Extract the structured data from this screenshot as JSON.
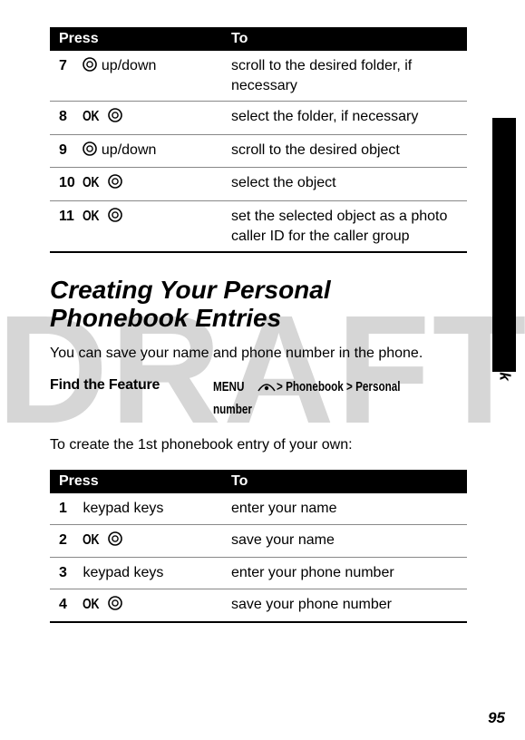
{
  "watermark": "DRAFT",
  "side_label": "Managing Your Phonebook",
  "page_number": "95",
  "table1": {
    "head_press": "Press",
    "head_to": "To",
    "rows": [
      {
        "num": "7",
        "key_prefix": "",
        "key_suffix": " up/down",
        "to": "scroll to the desired folder, if necessary"
      },
      {
        "num": "8",
        "key_prefix": "OK",
        "key_suffix": "",
        "to": "select the folder, if necessary"
      },
      {
        "num": "9",
        "key_prefix": "",
        "key_suffix": " up/down",
        "to": "scroll to the desired object"
      },
      {
        "num": "10",
        "key_prefix": "OK",
        "key_suffix": "",
        "to": "select the object"
      },
      {
        "num": "11",
        "key_prefix": "OK",
        "key_suffix": "",
        "to": "set the selected object as a photo caller ID for the caller group"
      }
    ]
  },
  "section_heading": "Creating Your Personal Phonebook Entries",
  "intro_para": "You can save your name and phone number in the phone.",
  "find_feature_label": "Find the Feature",
  "menu_label": "MENU",
  "menu_path_1": " > Phonebook > Personal",
  "menu_path_2": "number",
  "intro_para2": "To create the 1st phonebook entry of your own:",
  "table2": {
    "head_press": "Press",
    "head_to": "To",
    "rows": [
      {
        "num": "1",
        "key_text": "keypad keys",
        "ok": false,
        "to": "enter your name"
      },
      {
        "num": "2",
        "key_text": "OK",
        "ok": true,
        "to": "save your name"
      },
      {
        "num": "3",
        "key_text": "keypad keys",
        "ok": false,
        "to": "enter your phone number"
      },
      {
        "num": "4",
        "key_text": "OK",
        "ok": true,
        "to": "save your phone number"
      }
    ]
  }
}
